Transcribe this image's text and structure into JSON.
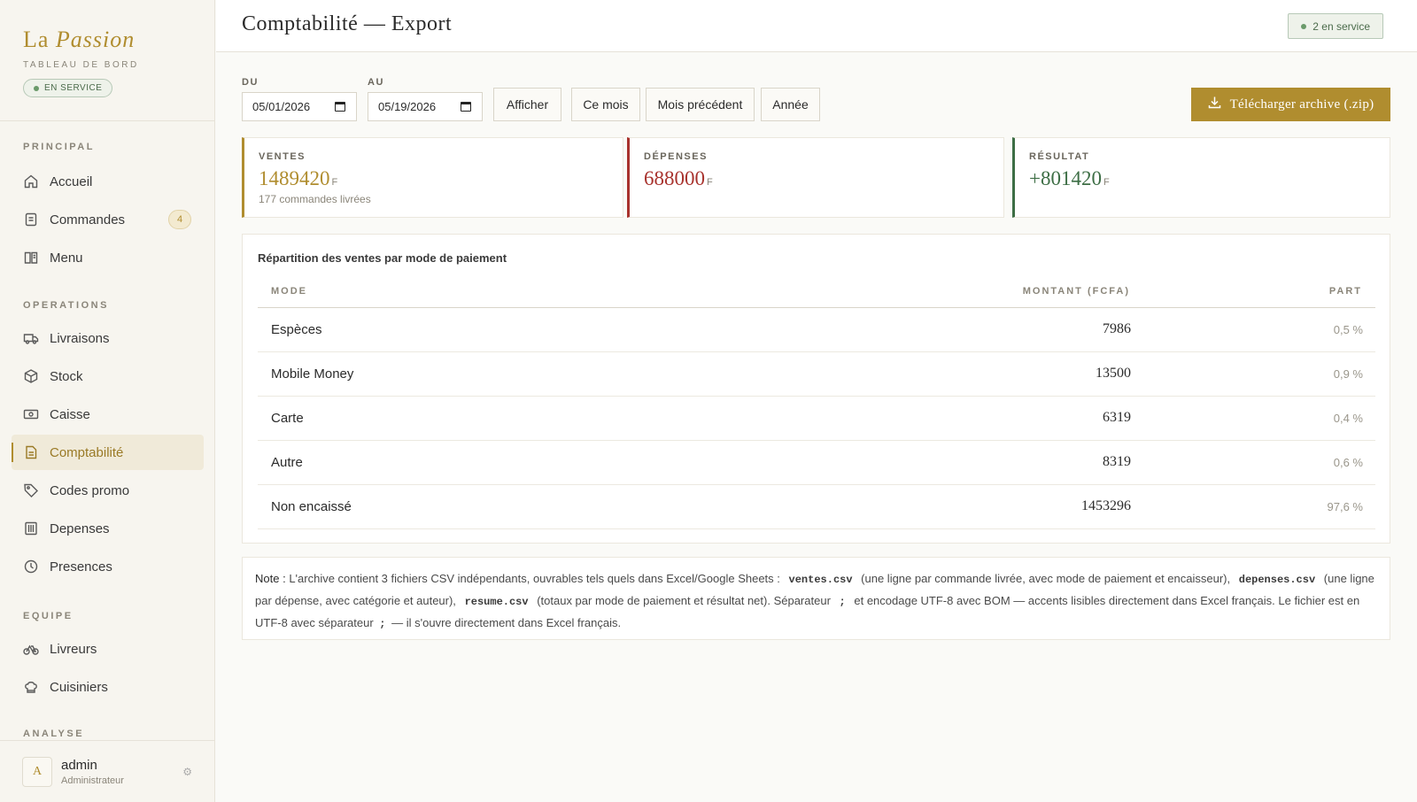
{
  "brand": {
    "name_part1": "La",
    "name_part2": "Passion",
    "subtitle": "TABLEAU DE BORD",
    "status": "EN SERVICE"
  },
  "nav": {
    "sections": {
      "principal": "PRINCIPAL",
      "operations": "OPERATIONS",
      "equipe": "EQUIPE",
      "analyse": "ANALYSE"
    },
    "items": {
      "accueil": "Accueil",
      "commandes": "Commandes",
      "commandes_badge": "4",
      "menu": "Menu",
      "livraisons": "Livraisons",
      "stock": "Stock",
      "caisse": "Caisse",
      "comptabilite": "Comptabilité",
      "codes_promo": "Codes promo",
      "depenses": "Depenses",
      "presences": "Presences",
      "livreurs": "Livreurs",
      "cuisiniers": "Cuisiniers"
    }
  },
  "user": {
    "initial": "A",
    "name": "admin",
    "role": "Administrateur"
  },
  "header": {
    "title": "Comptabilité — Export",
    "service_status": "2 en service"
  },
  "filters": {
    "from_label": "DU",
    "from_value": "05/01/2026",
    "to_label": "AU",
    "to_value": "05/19/2026",
    "show_button": "Afficher",
    "this_month": "Ce mois",
    "previous_month": "Mois précédent",
    "year": "Année",
    "download": "Télécharger archive (.zip)"
  },
  "summary": {
    "sales": {
      "label": "VENTES",
      "value": "1489420",
      "unit": "F",
      "sub": "177 commandes livrées"
    },
    "expenses": {
      "label": "DÉPENSES",
      "value": "688000",
      "unit": "F"
    },
    "result": {
      "label": "RÉSULTAT",
      "value": "+801420",
      "unit": "F"
    }
  },
  "colors": {
    "accent_gold": "#b08d2f",
    "expenses_red": "#a8322d",
    "result_green": "#3d6e45"
  },
  "breakdown": {
    "title": "Répartition des ventes par mode de paiement",
    "headers": {
      "mode": "MODE",
      "amount": "MONTANT (FCFA)",
      "share": "PART"
    },
    "rows": [
      {
        "mode": "Espèces",
        "amount": "7986",
        "share": "0,5 %"
      },
      {
        "mode": "Mobile Money",
        "amount": "13500",
        "share": "0,9 %"
      },
      {
        "mode": "Carte",
        "amount": "6319",
        "share": "0,4 %"
      },
      {
        "mode": "Autre",
        "amount": "8319",
        "share": "0,6 %"
      },
      {
        "mode": "Non encaissé",
        "amount": "1453296",
        "share": "97,6 %"
      }
    ]
  },
  "note": {
    "label": "Note :",
    "t1": "L'archive contient 3 fichiers CSV indépendants, ouvrables tels quels dans Excel/Google Sheets :",
    "f1": "ventes.csv",
    "t2": "(une ligne par commande livrée, avec mode de paiement et encaisseur),",
    "f2": "depenses.csv",
    "t3": "(une ligne par dépense, avec catégorie et auteur),",
    "f3": "resume.csv",
    "t4": "(totaux par mode de paiement et résultat net). Séparateur",
    "sep": ";",
    "t5": "et encodage UTF-8 avec BOM — accents lisibles directement dans Excel français. Le fichier est en UTF-8 avec séparateur",
    "sep2": ";",
    "t6": "— il s'ouvre directement dans Excel français."
  }
}
